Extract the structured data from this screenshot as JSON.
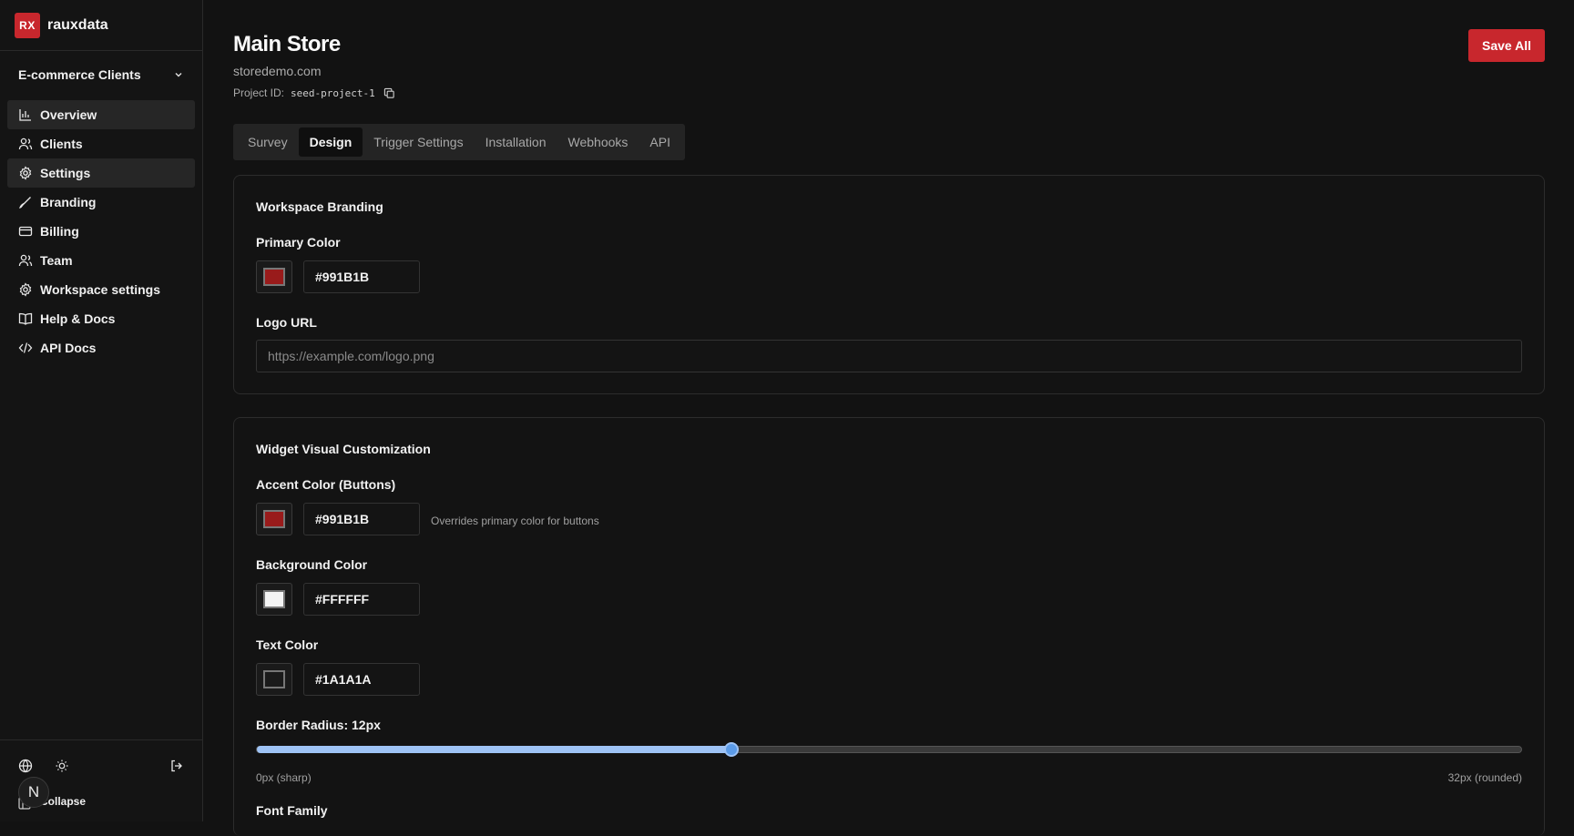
{
  "brand": {
    "logo_text": "RX",
    "name": "rauxdata"
  },
  "workspace": {
    "selected": "E-commerce Clients"
  },
  "nav": [
    {
      "label": "Overview",
      "icon": "bar-chart-icon",
      "active": true
    },
    {
      "label": "Clients",
      "icon": "users-icon",
      "active": false
    },
    {
      "label": "Settings",
      "icon": "gear-icon",
      "active": true
    },
    {
      "label": "Branding",
      "icon": "brush-icon",
      "active": false
    },
    {
      "label": "Billing",
      "icon": "credit-card-icon",
      "active": false
    },
    {
      "label": "Team",
      "icon": "users-icon",
      "active": false
    },
    {
      "label": "Workspace settings",
      "icon": "gear-icon",
      "active": false
    },
    {
      "label": "Help & Docs",
      "icon": "book-icon",
      "active": false
    },
    {
      "label": "API Docs",
      "icon": "code-icon",
      "active": false
    }
  ],
  "footer": {
    "avatar_initial": "N",
    "collapse_label": "Collapse"
  },
  "header": {
    "title": "Main Store",
    "domain": "storedemo.com",
    "project_id_label": "Project ID:",
    "project_id": "seed-project-1",
    "save_label": "Save All"
  },
  "tabs": [
    {
      "label": "Survey",
      "active": false
    },
    {
      "label": "Design",
      "active": true
    },
    {
      "label": "Trigger Settings",
      "active": false
    },
    {
      "label": "Installation",
      "active": false
    },
    {
      "label": "Webhooks",
      "active": false
    },
    {
      "label": "API",
      "active": false
    }
  ],
  "branding_card": {
    "title": "Workspace Branding",
    "primary_label": "Primary Color",
    "primary_value": "#991B1B",
    "logo_label": "Logo URL",
    "logo_placeholder": "https://example.com/logo.png"
  },
  "widget_card": {
    "title": "Widget Visual Customization",
    "accent_label": "Accent Color (Buttons)",
    "accent_value": "#991B1B",
    "accent_hint": "Overrides primary color for buttons",
    "background_label": "Background Color",
    "background_value": "#FFFFFF",
    "text_label": "Text Color",
    "text_value": "#1A1A1A",
    "radius_label": "Border Radius: 12px",
    "radius_value": 12,
    "radius_max": 32,
    "radius_min_label": "0px (sharp)",
    "radius_max_label": "32px (rounded)",
    "font_label": "Font Family"
  },
  "colors": {
    "accent": "#c8272d",
    "swatch_red": "#991B1B",
    "swatch_white": "#FFFFFF",
    "swatch_dark": "#1A1A1A",
    "slider": "#9ec3f5"
  }
}
